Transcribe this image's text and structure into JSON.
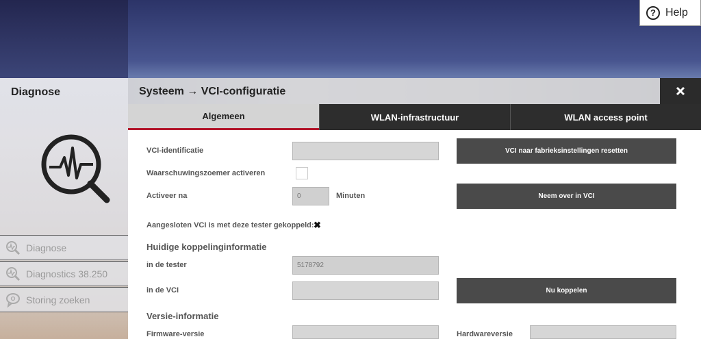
{
  "help": {
    "label": "Help",
    "icon": "?"
  },
  "sidebar": {
    "title": "Diagnose",
    "items": [
      {
        "label": "Diagnose",
        "icon": "diagnose-icon"
      },
      {
        "label": "Diagnostics 38.250",
        "icon": "diagnose-icon"
      },
      {
        "label": "Storing zoeken",
        "icon": "chat-icon"
      }
    ]
  },
  "header": {
    "title": "Systeem → VCI-configuratie",
    "close": "✖"
  },
  "tabs": [
    {
      "label": "Algemeen",
      "active": true
    },
    {
      "label": "WLAN-infrastructuur",
      "active": false
    },
    {
      "label": "WLAN access point",
      "active": false
    }
  ],
  "form": {
    "vci_id_label": "VCI-identificatie",
    "vci_id_value": "",
    "buzzer_label": "Waarschuwingszoemer activeren",
    "activate_label": "Activeer na",
    "activate_placeholder": "0",
    "activate_unit": "Minuten",
    "coupled_label": "Aangesloten VCI is met deze tester gekoppeld:",
    "coupled_status": "✖",
    "reset_button": "VCI naar fabrieksinstellingen resetten",
    "apply_button": "Neem over in VCI",
    "coupling_section": "Huidige koppelinginformatie",
    "in_tester_label": "in de tester",
    "in_tester_value": "5178792",
    "in_vci_label": "in de VCI",
    "in_vci_value": "",
    "couple_button": "Nu koppelen",
    "version_section": "Versie-informatie",
    "firmware_label": "Firmware-versie",
    "firmware_value": "",
    "hardware_label": "Hardwareversie",
    "hardware_value": ""
  },
  "colors": {
    "accent": "#b3162b",
    "dark_button": "#4a4a4a",
    "tab_dark": "#2d2d2d"
  }
}
